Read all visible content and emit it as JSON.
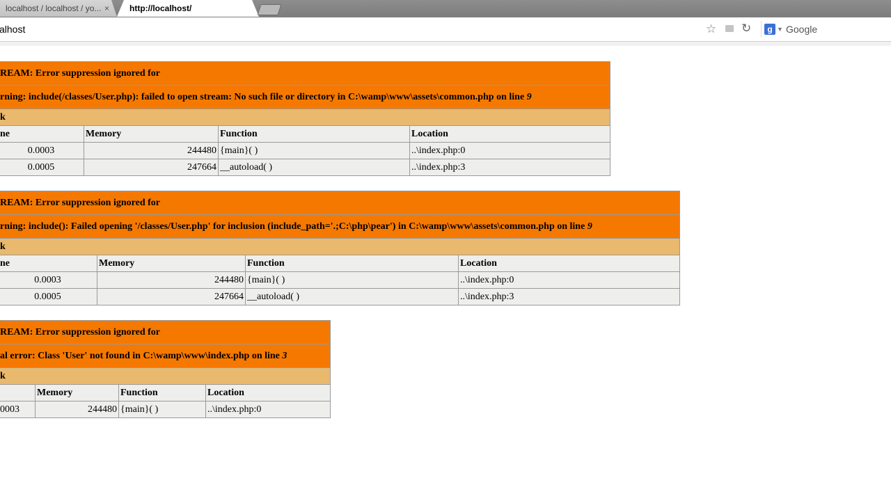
{
  "browser": {
    "tabs": [
      {
        "label": "localhost / localhost / yo...",
        "close": "×"
      },
      {
        "label": "http://localhost/"
      }
    ],
    "address": "calhost",
    "search_engine": "Google"
  },
  "errors": [
    {
      "title": "REAM: Error suppression ignored for",
      "message": "rning: include(/classes/User.php): failed to open stream: No such file or directory in C:\\wamp\\www\\assets\\common.php on line ",
      "line": "9",
      "callstack_label": "k",
      "headers": [
        "ne",
        "Memory",
        "Function",
        "Location"
      ],
      "rows": [
        {
          "time": "0.0003",
          "memory": "244480",
          "function": "{main}( )",
          "location": "..\\index.php:0"
        },
        {
          "time": "0.0005",
          "memory": "247664",
          "function": "__autoload( )",
          "location": "..\\index.php:3"
        }
      ]
    },
    {
      "title": "REAM: Error suppression ignored for",
      "message": "rning: include(): Failed opening '/classes/User.php' for inclusion (include_path='.;C:\\php\\pear') in C:\\wamp\\www\\assets\\common.php on line ",
      "line": "9",
      "callstack_label": "k",
      "headers": [
        "ne",
        "Memory",
        "Function",
        "Location"
      ],
      "rows": [
        {
          "time": "0.0003",
          "memory": "244480",
          "function": "{main}( )",
          "location": "..\\index.php:0"
        },
        {
          "time": "0.0005",
          "memory": "247664",
          "function": "__autoload( )",
          "location": "..\\index.php:3"
        }
      ]
    },
    {
      "title": "REAM: Error suppression ignored for",
      "message": "al error: Class 'User' not found in C:\\wamp\\www\\index.php on line ",
      "line": "3",
      "callstack_label": "k",
      "headers": [
        "",
        "Memory",
        "Function",
        "Location"
      ],
      "rows": [
        {
          "time": "0003",
          "memory": "244480",
          "function": "{main}( )",
          "location": "..\\index.php:0"
        }
      ]
    }
  ]
}
